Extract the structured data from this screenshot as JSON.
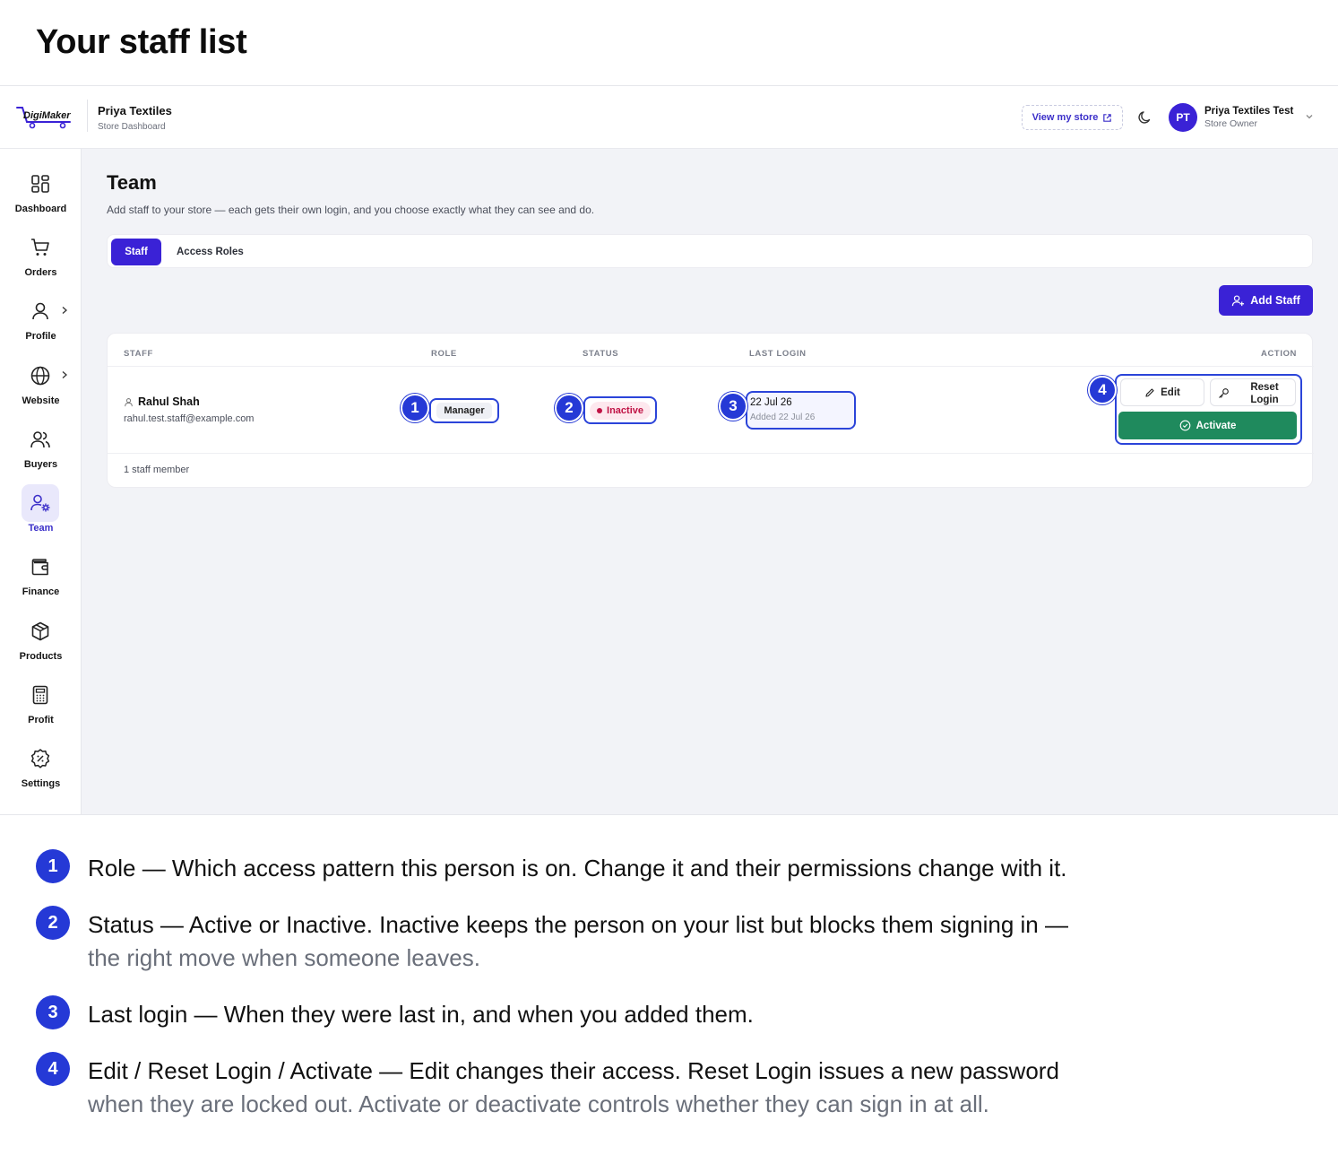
{
  "page_heading": "Your staff list",
  "topbar": {
    "logo_text": "DigiMaker",
    "store_name": "Priya Textiles",
    "store_subtitle": "Store Dashboard",
    "view_store_label": "View my store",
    "avatar_initials": "PT",
    "user_name": "Priya Textiles Test",
    "user_role": "Store Owner"
  },
  "sidebar": {
    "items": [
      {
        "label": "Dashboard",
        "icon": "dashboard-icon"
      },
      {
        "label": "Orders",
        "icon": "cart-icon"
      },
      {
        "label": "Profile",
        "icon": "user-icon"
      },
      {
        "label": "Website",
        "icon": "globe-icon"
      },
      {
        "label": "Buyers",
        "icon": "users-icon"
      },
      {
        "label": "Team",
        "icon": "user-gear-icon",
        "active": true
      },
      {
        "label": "Finance",
        "icon": "wallet-icon"
      },
      {
        "label": "Products",
        "icon": "box-icon"
      },
      {
        "label": "Profit",
        "icon": "calculator-icon"
      },
      {
        "label": "Settings",
        "icon": "settings-icon"
      }
    ]
  },
  "main": {
    "title": "Team",
    "description": "Add staff to your store — each gets their own login, and you choose exactly what they can see and do.",
    "tabs": [
      {
        "label": "Staff",
        "active": true
      },
      {
        "label": "Access Roles",
        "active": false
      }
    ],
    "add_staff_label": "Add Staff",
    "table": {
      "headers": [
        "STAFF",
        "ROLE",
        "STATUS",
        "LAST LOGIN",
        "ACTION"
      ],
      "rows": [
        {
          "name": "Rahul Shah",
          "email": "rahul.test.staff@example.com",
          "role": "Manager",
          "status": "Inactive",
          "last_login": "22 Jul 26",
          "added": "Added 22 Jul 26",
          "actions": {
            "edit": "Edit",
            "reset": "Reset Login",
            "activate": "Activate"
          }
        }
      ],
      "footer": "1 staff member"
    }
  },
  "callouts": [
    "1",
    "2",
    "3",
    "4"
  ],
  "legend": [
    {
      "num": "1",
      "text": "Role — Which access pattern this person is on. Change it and their permissions change with it.",
      "continuation": ""
    },
    {
      "num": "2",
      "text": "Status — Active or Inactive. Inactive keeps the person on your list but blocks them signing in —",
      "continuation": "the right move when someone leaves."
    },
    {
      "num": "3",
      "text": "Last login — When they were last in, and when you added them.",
      "continuation": ""
    },
    {
      "num": "4",
      "text": "Edit / Reset Login / Activate — Edit changes their access. Reset Login issues a new password",
      "continuation": "when they are locked out. Activate or deactivate controls whether they can sign in at all."
    }
  ],
  "colors": {
    "accent": "#3a22d6",
    "callout": "#2539d6",
    "inactive": "#c01345",
    "activate": "#1f8a5d"
  }
}
